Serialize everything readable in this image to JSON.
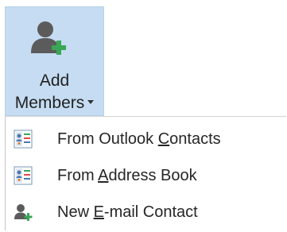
{
  "ribbon_button": {
    "line1": "Add",
    "line2": "Members",
    "icon": "add-person-icon",
    "state": "open"
  },
  "menu": {
    "items": [
      {
        "pre": "From Outlook ",
        "accel": "C",
        "post": "ontacts",
        "icon": "address-book-icon"
      },
      {
        "pre": "From ",
        "accel": "A",
        "post": "ddress Book",
        "icon": "address-book-icon"
      },
      {
        "pre": "New ",
        "accel": "E",
        "post": "-mail Contact",
        "icon": "add-contact-icon"
      }
    ]
  },
  "colors": {
    "ribbon_pressed": "#c5dcf2",
    "icon_gray": "#5b5b5b",
    "icon_green": "#3aa757",
    "text": "#262626"
  }
}
